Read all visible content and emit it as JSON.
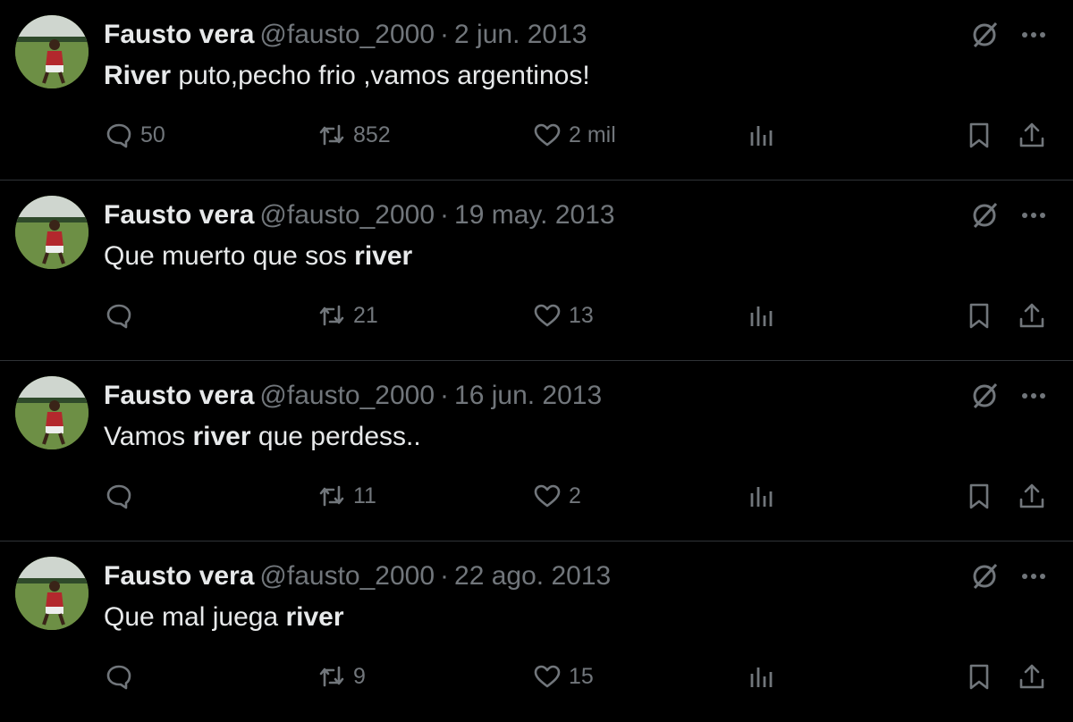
{
  "tweets": [
    {
      "author_name": "Fausto vera",
      "handle": "@fausto_2000",
      "separator": "·",
      "date": "2 jun. 2013",
      "text_bold_start": "River",
      "text_plain": " puto,pecho frio ,vamos argentinos!",
      "text_bold_end": "",
      "replies": "50",
      "retweets": "852",
      "likes": "2 mil"
    },
    {
      "author_name": "Fausto vera",
      "handle": "@fausto_2000",
      "separator": "·",
      "date": "19 may. 2013",
      "text_bold_start": "",
      "text_plain": "Que muerto que sos ",
      "text_bold_end": "river",
      "replies": "",
      "retweets": "21",
      "likes": "13"
    },
    {
      "author_name": "Fausto vera",
      "handle": "@fausto_2000",
      "separator": "·",
      "date": "16 jun. 2013",
      "text_pre": "Vamos ",
      "text_bold_mid": "river",
      "text_post": " que perdess..",
      "replies": "",
      "retweets": "11",
      "likes": "2"
    },
    {
      "author_name": "Fausto vera",
      "handle": "@fausto_2000",
      "separator": "·",
      "date": "22 ago. 2013",
      "text_bold_start": "",
      "text_plain": "Que mal juega ",
      "text_bold_end": "river",
      "replies": "",
      "retweets": "9",
      "likes": "15"
    }
  ],
  "icons": {
    "reply": "reply-icon",
    "retweet": "retweet-icon",
    "like": "heart-icon",
    "views": "views-icon",
    "bookmark": "bookmark-icon",
    "share": "share-icon",
    "grok": "grok-icon",
    "more": "more-icon"
  },
  "colors": {
    "background": "#000000",
    "text": "#e7e9ea",
    "secondary": "#71767b",
    "divider": "#2f3336"
  }
}
